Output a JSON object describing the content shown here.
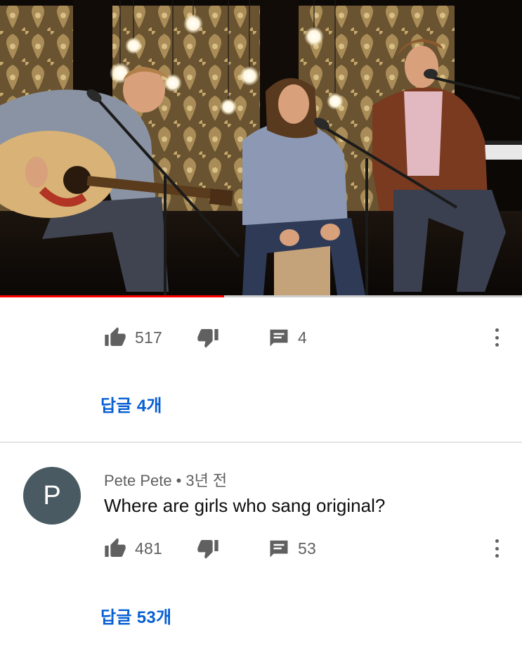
{
  "video": {
    "progress_percent": 43
  },
  "comment_1": {
    "likes": "517",
    "reply_count": "4",
    "view_replies_label": "답글 4개"
  },
  "comment_2": {
    "avatar_letter": "P",
    "author": "Pete Pete",
    "separator": "•",
    "time": "3년 전",
    "text": "Where are girls who sang original?",
    "likes": "481",
    "reply_count": "53",
    "view_replies_label": "답글 53개"
  },
  "icons": {
    "like": "thumbs-up-icon",
    "dislike": "thumbs-down-icon",
    "reply": "comment-icon",
    "more": "more-vert-icon"
  },
  "colors": {
    "link": "#065fd4",
    "progress": "#ff0000",
    "avatar_bg": "#4a5a62"
  }
}
